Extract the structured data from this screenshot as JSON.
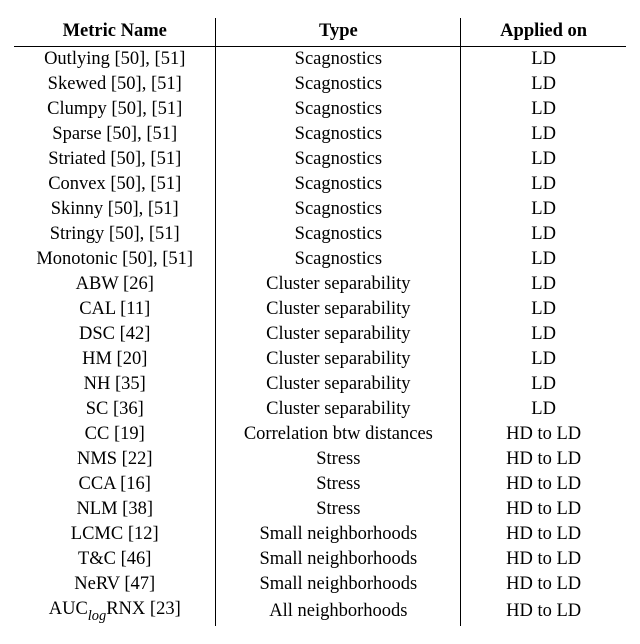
{
  "headers": {
    "metric": "Metric Name",
    "type": "Type",
    "applied": "Applied on"
  },
  "rows": [
    {
      "metric": "Outlying [50], [51]",
      "type": "Scagnostics",
      "applied": "LD"
    },
    {
      "metric": "Skewed [50], [51]",
      "type": "Scagnostics",
      "applied": "LD"
    },
    {
      "metric": "Clumpy [50], [51]",
      "type": "Scagnostics",
      "applied": "LD"
    },
    {
      "metric": "Sparse [50], [51]",
      "type": "Scagnostics",
      "applied": "LD"
    },
    {
      "metric": "Striated [50], [51]",
      "type": "Scagnostics",
      "applied": "LD"
    },
    {
      "metric": "Convex [50], [51]",
      "type": "Scagnostics",
      "applied": "LD"
    },
    {
      "metric": "Skinny [50], [51]",
      "type": "Scagnostics",
      "applied": "LD"
    },
    {
      "metric": "Stringy [50], [51]",
      "type": "Scagnostics",
      "applied": "LD"
    },
    {
      "metric": "Monotonic [50], [51]",
      "type": "Scagnostics",
      "applied": "LD"
    },
    {
      "metric": "ABW [26]",
      "type": "Cluster separability",
      "applied": "LD"
    },
    {
      "metric": "CAL [11]",
      "type": "Cluster separability",
      "applied": "LD"
    },
    {
      "metric": "DSC [42]",
      "type": "Cluster separability",
      "applied": "LD"
    },
    {
      "metric": "HM [20]",
      "type": "Cluster separability",
      "applied": "LD"
    },
    {
      "metric": "NH [35]",
      "type": "Cluster separability",
      "applied": "LD"
    },
    {
      "metric": "SC [36]",
      "type": "Cluster separability",
      "applied": "LD"
    },
    {
      "metric": "CC [19]",
      "type": "Correlation btw distances",
      "applied": "HD to LD"
    },
    {
      "metric": "NMS [22]",
      "type": "Stress",
      "applied": "HD to LD"
    },
    {
      "metric": "CCA [16]",
      "type": "Stress",
      "applied": "HD to LD"
    },
    {
      "metric": "NLM [38]",
      "type": "Stress",
      "applied": "HD to LD"
    },
    {
      "metric": "LCMC [12]",
      "type": "Small neighborhoods",
      "applied": "HD to LD"
    },
    {
      "metric": "T&C [46]",
      "type": "Small neighborhoods",
      "applied": "HD to LD"
    },
    {
      "metric": "NeRV [47]",
      "type": "Small neighborhoods",
      "applied": "HD to LD"
    },
    {
      "metric_html": "AUC<span class=\"sub\">log</span>RNX [23]",
      "type": "All neighborhoods",
      "applied": "HD to LD"
    }
  ]
}
